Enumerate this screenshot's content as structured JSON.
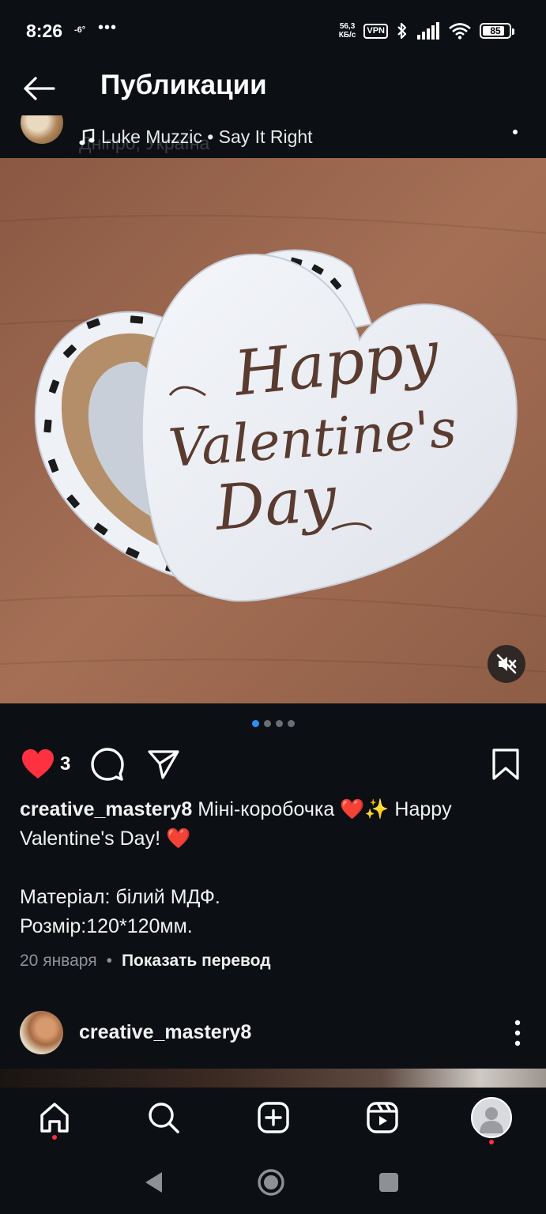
{
  "status_bar": {
    "time": "8:26",
    "temp": "-6°",
    "more": "•••",
    "net_speed_value": "56,3",
    "net_speed_unit": "КБ/с",
    "vpn": "VPN",
    "battery": "85",
    "battery_level": 0.85
  },
  "header": {
    "title": "Публикации"
  },
  "post": {
    "location": "Дніпро, Україна",
    "music": "Luke Muzzic • Say It Right",
    "likes": "3",
    "carousel": {
      "count": 4,
      "active": 0
    },
    "caption": {
      "user": "creative_mastery8",
      "line1": "Міні-коробочка ❤️✨ Happy",
      "line2": "Valentine's Day! ❤️",
      "line3": "",
      "line4": "Матеріал: білий МДФ.",
      "line5": "Розмір:120*120мм."
    },
    "date": "20 января",
    "translate": "Показать перевод"
  },
  "photo_text": {
    "line1": "Happy",
    "line2": "Valentine's",
    "line3": "Day"
  },
  "next_post": {
    "user": "creative_mastery8"
  },
  "icons": {
    "back": "arrow-left-icon",
    "music": "music-note-icon",
    "mute": "speaker-muted-icon",
    "like": "heart-filled-icon",
    "comment": "comment-icon",
    "share": "send-icon",
    "save": "bookmark-icon",
    "home": "home-icon",
    "search": "search-icon",
    "create": "plus-square-icon",
    "reels": "reels-icon",
    "profile": "profile-avatar-icon"
  },
  "colors": {
    "background": "#0c0f14",
    "like": "#ff3040",
    "active_dot": "#2d8ff5",
    "muted_text": "#8f9399"
  }
}
